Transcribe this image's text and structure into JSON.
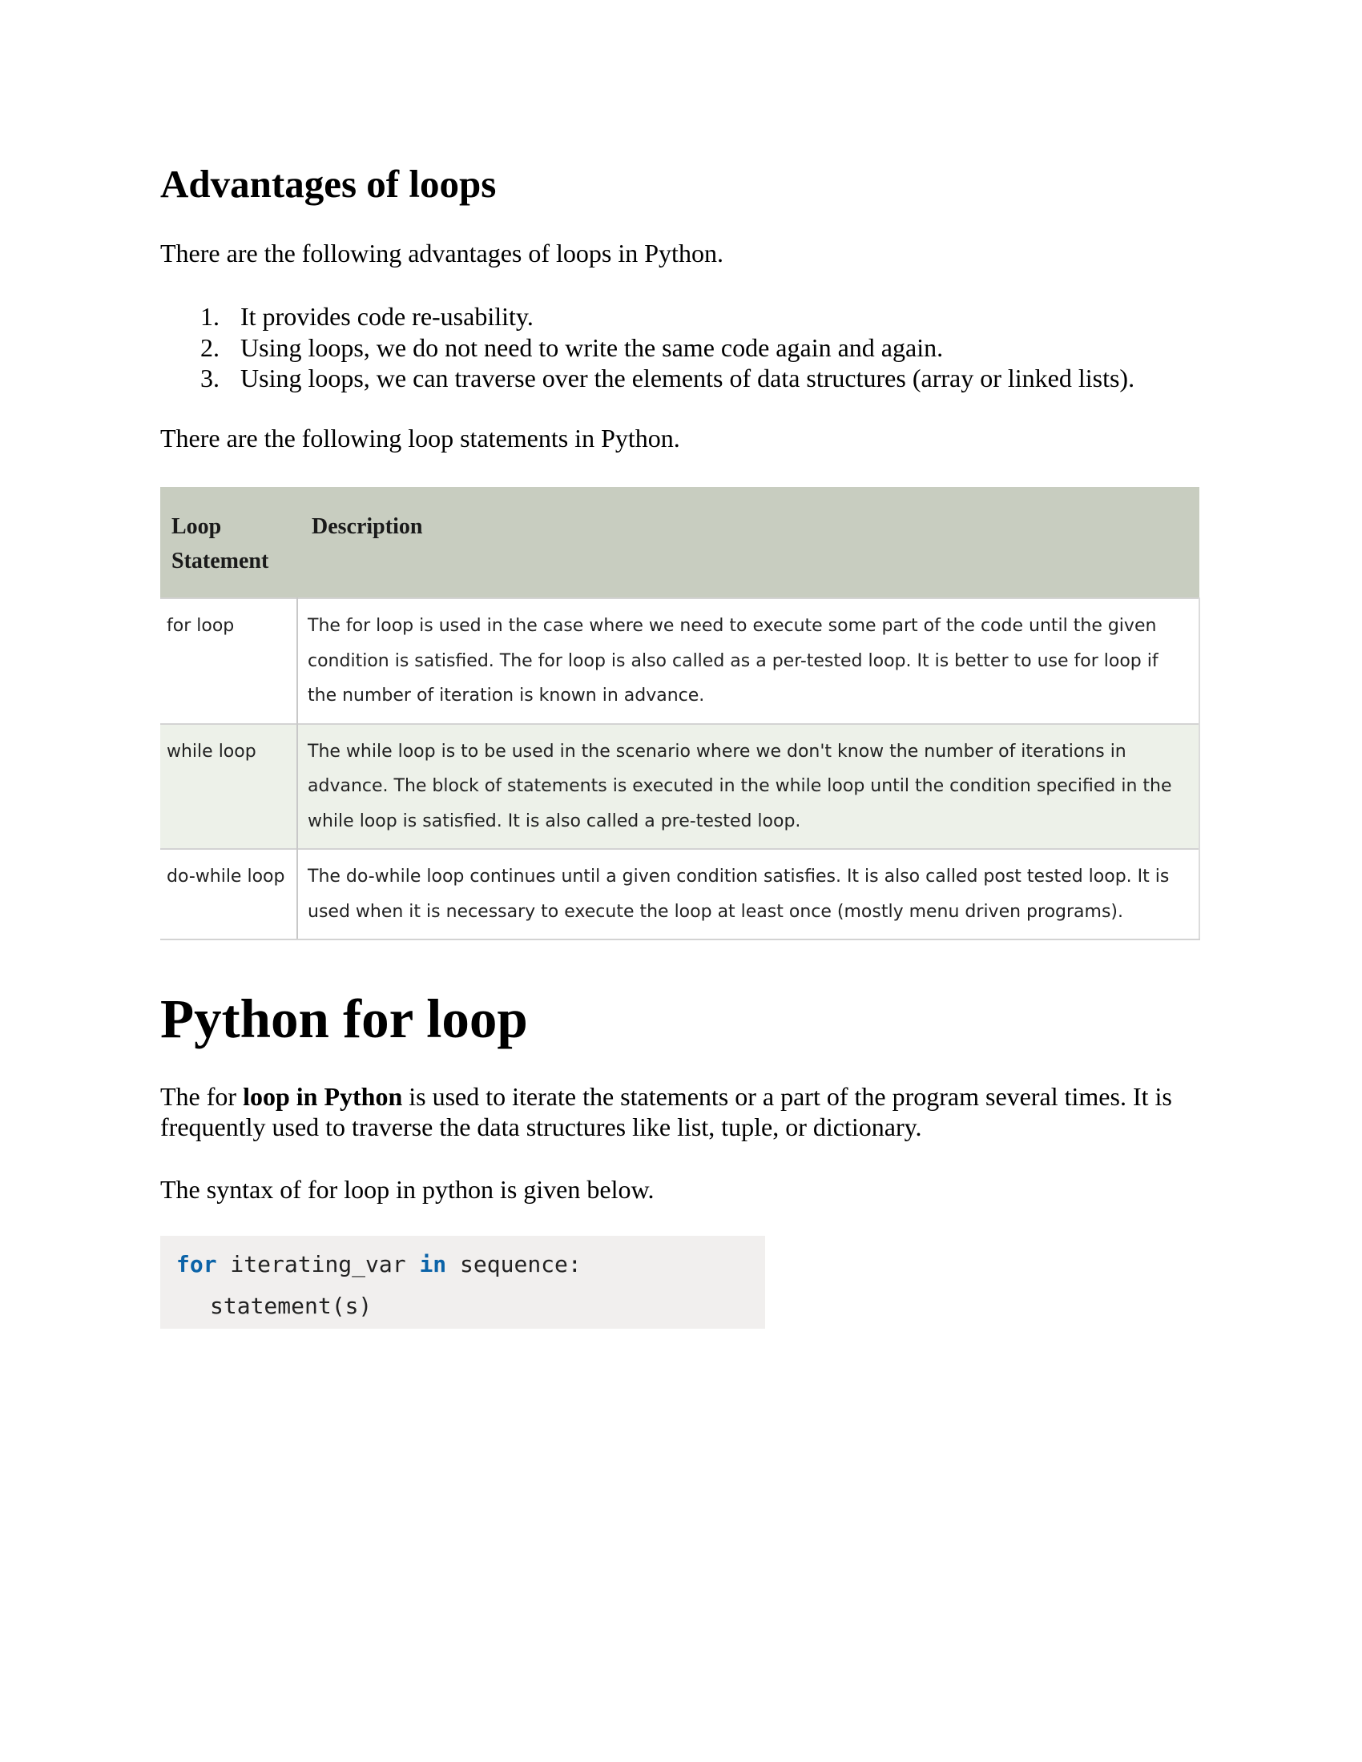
{
  "section1": {
    "heading": "Advantages of loops",
    "intro": "There are the following advantages of loops in Python.",
    "advantages": [
      {
        "num": "1.",
        "text": "It provides code re-usability."
      },
      {
        "num": "2.",
        "text": "Using loops, we do not need to write the same code again and again."
      },
      {
        "num": "3.",
        "text": "Using loops, we can traverse over the elements of data structures (array or linked lists)."
      }
    ],
    "statements_intro": "There are the following loop statements in Python."
  },
  "table": {
    "headers": {
      "col1_line1": "Loop",
      "col1_line2": "Statement",
      "col2": "Description"
    },
    "rows": [
      {
        "statement": "for loop",
        "description": "The for loop is used in the case where we need to execute some part of the code until the given condition is satisfied. The for loop is also called as a per-tested loop. It is better to use for loop if the number of iteration is known in advance."
      },
      {
        "statement": "while loop",
        "description": "The while loop is to be used in the scenario where we don't know the number of iterations in advance. The block of statements is executed in the while loop until the condition specified in the while loop is satisfied. It is also called a pre-tested loop."
      },
      {
        "statement": "do-while loop",
        "description": "The do-while loop continues until a given condition satisfies. It is also called post tested loop. It is used when it is necessary to execute the loop at least once (mostly menu driven programs)."
      }
    ]
  },
  "section2": {
    "heading": "Python for loop",
    "para1_prefix": "The for ",
    "para1_bold": "loop in Python",
    "para1_suffix": " is used to iterate the statements or a part of the program several times. It is frequently used to traverse the data structures like list, tuple, or dictionary.",
    "syntax_intro": "The syntax of for loop in python is given below."
  },
  "code": {
    "kw_for": "for",
    "var": " iterating_var ",
    "kw_in": "in",
    "seq": " sequence:",
    "line2": "statement(s)"
  },
  "colors": {
    "table_header_bg": "#c8cdc0",
    "table_alt_row_bg": "#edf1e9",
    "code_bg": "#f1efee",
    "code_keyword": "#0b63a8"
  }
}
